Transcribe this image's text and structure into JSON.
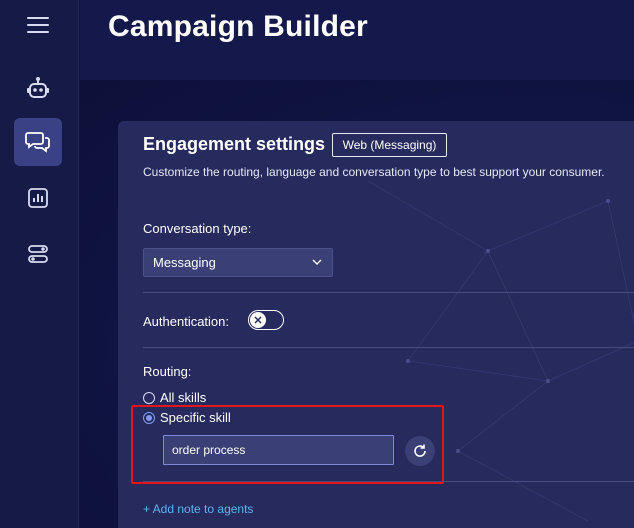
{
  "header": {
    "title": "Campaign Builder"
  },
  "sidebar": {
    "items": [
      {
        "icon": "bot-icon",
        "active": false
      },
      {
        "icon": "chat-bubbles-icon",
        "active": true
      },
      {
        "icon": "report-chart-icon",
        "active": false
      },
      {
        "icon": "settings-toggles-icon",
        "active": false
      }
    ]
  },
  "engagement": {
    "title": "Engagement settings",
    "channel_badge": "Web (Messaging)",
    "description": "Customize the routing, language and conversation type to best support your consumer.",
    "conversation_type": {
      "label": "Conversation type:",
      "selected": "Messaging"
    },
    "authentication": {
      "label": "Authentication:",
      "enabled": false
    },
    "routing": {
      "label": "Routing:",
      "options": [
        "All skills",
        "Specific skill"
      ],
      "selected": "Specific skill",
      "skill_value": "order process"
    },
    "add_note_label": "+ Add note to agents"
  },
  "colors": {
    "accent": "#7f9cf5",
    "highlight": "#e0151d",
    "link": "#5fb4f0"
  }
}
